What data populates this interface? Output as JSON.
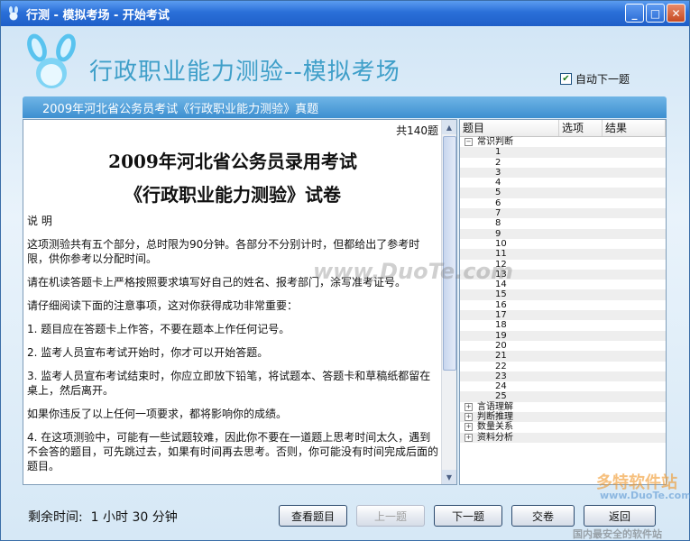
{
  "window": {
    "title": "行测 - 模拟考场 - 开始考试"
  },
  "header": {
    "app_title": "行政职业能力测验--模拟考场",
    "auto_next_label": "自动下一题",
    "auto_next_checked": true
  },
  "banner": {
    "text": "2009年河北省公务员考试《行政职业能力测验》真题"
  },
  "content": {
    "count": "共140题",
    "heading1": "2009年河北省公务员录用考试",
    "heading2": "《行政职业能力测验》试卷",
    "paragraphs": [
      "说 明",
      "这项测验共有五个部分，总时限为90分钟。各部分不分别计时，但都给出了参考时限，供你参考以分配时间。",
      "请在机读答题卡上严格按照要求填写好自己的姓名、报考部门，涂写准考证号。",
      "请仔细阅读下面的注意事项，这对你获得成功非常重要：",
      "1. 题目应在答题卡上作答，不要在题本上作任何记号。",
      "2. 监考人员宣布考试开始时，你才可以开始答题。",
      "3. 监考人员宣布考试结束时，你应立即放下铅笔，将试题本、答题卡和草稿纸都留在桌上，然后离开。",
      "如果你违反了以上任何一项要求，都将影响你的成绩。",
      "4. 在这项测验中，可能有一些试题较难，因此你不要在一道题上思考时间太久，遇到不会答的题目，可先跳过去，如果有时间再去思考。否则，你可能没有时间完成后面的题目。"
    ]
  },
  "tree": {
    "columns": [
      "题目",
      "选项",
      "结果"
    ],
    "expanded_category": "常识判断",
    "questions": [
      "1",
      "2",
      "3",
      "4",
      "5",
      "6",
      "7",
      "8",
      "9",
      "10",
      "11",
      "12",
      "13",
      "14",
      "15",
      "16",
      "17",
      "18",
      "19",
      "20",
      "21",
      "22",
      "23",
      "24",
      "25"
    ],
    "other_categories": [
      "言语理解",
      "判断推理",
      "数量关系",
      "资料分析"
    ]
  },
  "footer": {
    "time_label": "剩余时间:",
    "hours": "1",
    "hour_unit": "小时",
    "minutes": "30",
    "minute_unit": "分钟",
    "buttons": {
      "view": "查看题目",
      "prev": "上一题",
      "next": "下一题",
      "submit": "交卷",
      "back": "返回"
    }
  },
  "watermarks": {
    "center": "www.DuoTe.com",
    "corner_logo": "多特软件站",
    "corner_url": "www.DuoTe.com",
    "corner_slogan": "国内最安全的软件站"
  }
}
